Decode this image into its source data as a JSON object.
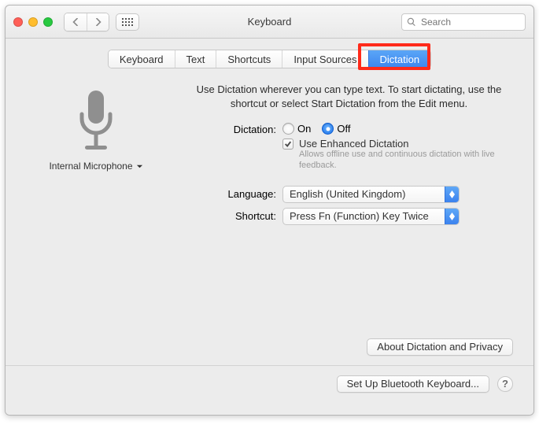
{
  "titlebar": {
    "title": "Keyboard",
    "search_placeholder": "Search"
  },
  "tabs": [
    "Keyboard",
    "Text",
    "Shortcuts",
    "Input Sources",
    "Dictation"
  ],
  "active_tab_index": 4,
  "mic": {
    "label": "Internal Microphone"
  },
  "description": "Use Dictation wherever you can type text. To start dictating, use the shortcut or select Start Dictation from the Edit menu.",
  "dictation": {
    "label": "Dictation:",
    "on_label": "On",
    "off_label": "Off",
    "selected": "off",
    "enhanced_label": "Use Enhanced Dictation",
    "enhanced_desc": "Allows offline use and continuous dictation with live feedback.",
    "enhanced_checked": true
  },
  "language": {
    "label": "Language:",
    "value": "English (United Kingdom)"
  },
  "shortcut": {
    "label": "Shortcut:",
    "value": "Press Fn (Function) Key Twice"
  },
  "buttons": {
    "about": "About Dictation and Privacy",
    "bluetooth": "Set Up Bluetooth Keyboard...",
    "help": "?"
  },
  "colors": {
    "accent": "#3e86ef",
    "highlight": "#ff2a1a"
  }
}
